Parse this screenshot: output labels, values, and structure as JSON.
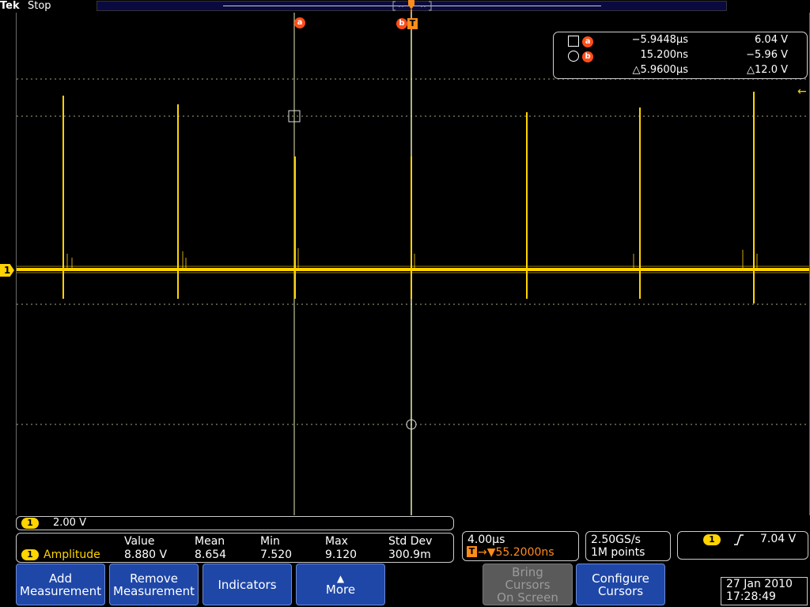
{
  "header": {
    "brand": "Tek",
    "state": "Stop"
  },
  "cursors": {
    "a_label": "a",
    "b_label": "b",
    "trigger_label": "T",
    "readout": {
      "a": {
        "time": "−5.9448µs",
        "value": "6.04 V"
      },
      "b": {
        "time": "15.200ns",
        "value": "−5.96 V"
      },
      "delta": {
        "time": "△5.9600µs",
        "value": "△12.0 V"
      }
    }
  },
  "channel": {
    "number": "1",
    "scale": "2.00 V",
    "color": "#ffd400"
  },
  "measurement": {
    "name": "Amplitude",
    "headers": [
      "Value",
      "Mean",
      "Min",
      "Max",
      "Std Dev"
    ],
    "values": [
      "8.880 V",
      "8.654",
      "7.520",
      "9.120",
      "300.9m"
    ]
  },
  "timebase": {
    "scale": "4.00µs",
    "trigger_delay": "→▼55.2000ns"
  },
  "acquisition": {
    "sample_rate": "2.50GS/s",
    "record_length": "1M points"
  },
  "trigger": {
    "source": "1",
    "level": "7.04 V"
  },
  "softkeys": {
    "add": "Add\nMeasurement",
    "remove": "Remove\nMeasurement",
    "indicators": "Indicators",
    "more": "More",
    "bring": "Bring\nCursors\nOn Screen",
    "configure": "Configure\nCursors"
  },
  "datetime": {
    "date": "27 Jan  2010",
    "time": "17:28:49"
  }
}
